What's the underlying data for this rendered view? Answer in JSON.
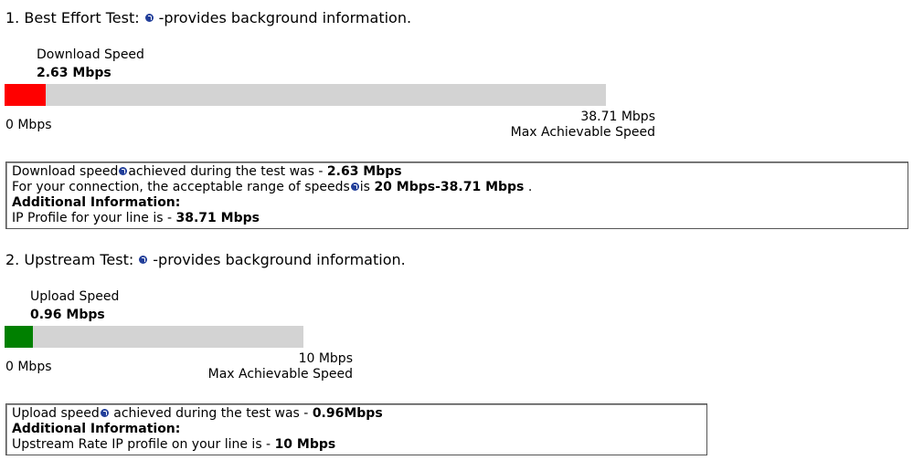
{
  "best_effort": {
    "heading_prefix": "1. Best Effort Test:",
    "heading_suffix": "-provides background information.",
    "speed_label": "Download Speed",
    "speed_value": "2.63 Mbps",
    "bar_fraction": 0.068,
    "bar_color": "#ff0000",
    "min_label": "0 Mbps",
    "max_value": "38.71 Mbps",
    "max_caption": "Max Achievable Speed",
    "info": {
      "line1_prefix": "Download speed",
      "line1_mid": "achieved during the test was - ",
      "line1_value": "2.63 Mbps",
      "line2_prefix": "For your connection, the acceptable range of speeds",
      "line2_mid": "is ",
      "line2_value": "20 Mbps-38.71 Mbps",
      "line2_suffix": " .",
      "additional_heading": "Additional Information:",
      "line3_prefix": "IP Profile for your line is - ",
      "line3_value": "38.71 Mbps"
    }
  },
  "upstream": {
    "heading_prefix": "2. Upstream Test:",
    "heading_suffix": "-provides background information.",
    "speed_label": "Upload Speed",
    "speed_value": "0.96 Mbps",
    "bar_fraction": 0.096,
    "bar_color": "#008000",
    "min_label": "0 Mbps",
    "max_value": "10 Mbps",
    "max_caption": "Max Achievable Speed",
    "info": {
      "line1_prefix": "Upload speed",
      "line1_mid": " achieved during the test was - ",
      "line1_value": "0.96Mbps",
      "additional_heading": "Additional Information:",
      "line3_prefix": "Upstream Rate IP profile on your line is - ",
      "line3_value": "10 Mbps"
    }
  },
  "icons": {
    "help": "question-mark-icon"
  }
}
